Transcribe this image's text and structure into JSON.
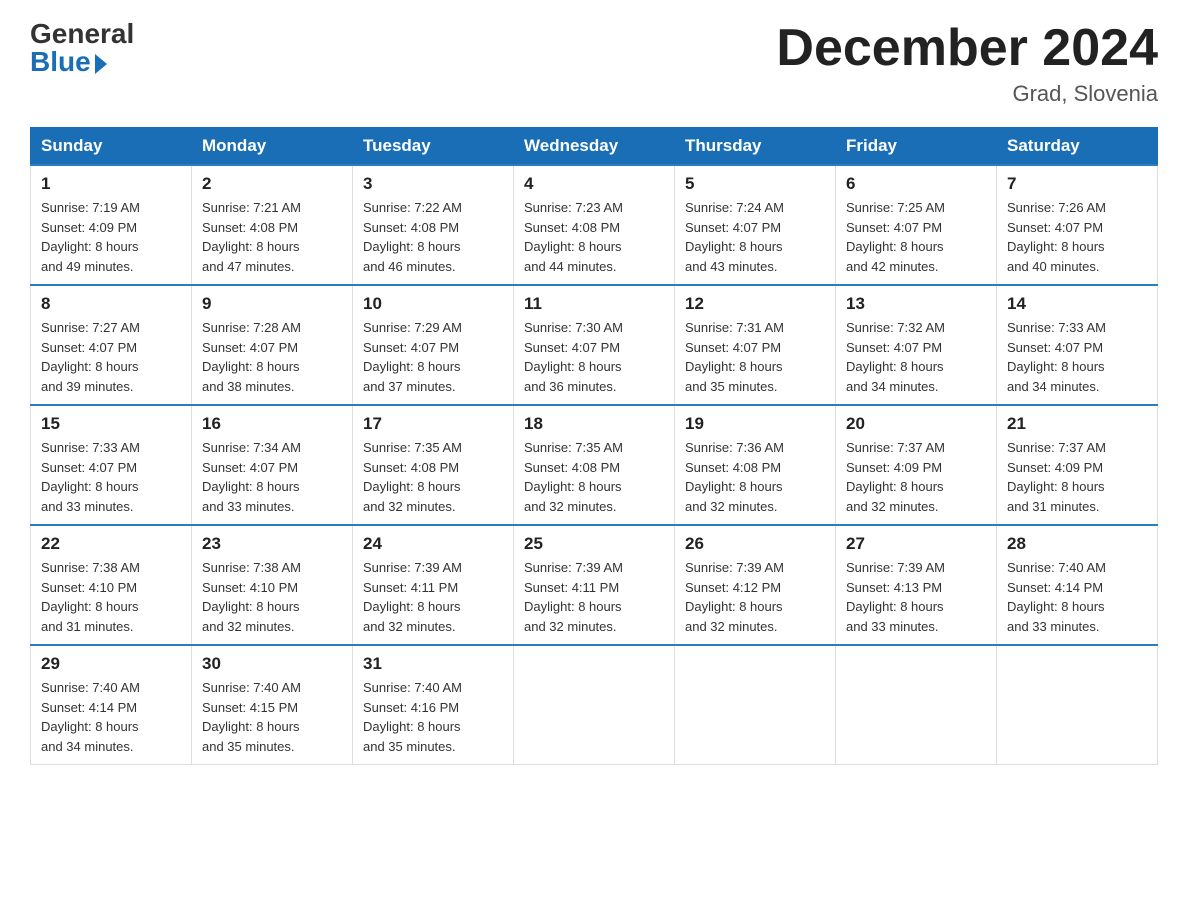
{
  "header": {
    "logo_general": "General",
    "logo_blue": "Blue",
    "month_title": "December 2024",
    "location": "Grad, Slovenia"
  },
  "days_of_week": [
    "Sunday",
    "Monday",
    "Tuesday",
    "Wednesday",
    "Thursday",
    "Friday",
    "Saturday"
  ],
  "weeks": [
    [
      {
        "day": "1",
        "sunrise": "7:19 AM",
        "sunset": "4:09 PM",
        "daylight": "8 hours and 49 minutes."
      },
      {
        "day": "2",
        "sunrise": "7:21 AM",
        "sunset": "4:08 PM",
        "daylight": "8 hours and 47 minutes."
      },
      {
        "day": "3",
        "sunrise": "7:22 AM",
        "sunset": "4:08 PM",
        "daylight": "8 hours and 46 minutes."
      },
      {
        "day": "4",
        "sunrise": "7:23 AM",
        "sunset": "4:08 PM",
        "daylight": "8 hours and 44 minutes."
      },
      {
        "day": "5",
        "sunrise": "7:24 AM",
        "sunset": "4:07 PM",
        "daylight": "8 hours and 43 minutes."
      },
      {
        "day": "6",
        "sunrise": "7:25 AM",
        "sunset": "4:07 PM",
        "daylight": "8 hours and 42 minutes."
      },
      {
        "day": "7",
        "sunrise": "7:26 AM",
        "sunset": "4:07 PM",
        "daylight": "8 hours and 40 minutes."
      }
    ],
    [
      {
        "day": "8",
        "sunrise": "7:27 AM",
        "sunset": "4:07 PM",
        "daylight": "8 hours and 39 minutes."
      },
      {
        "day": "9",
        "sunrise": "7:28 AM",
        "sunset": "4:07 PM",
        "daylight": "8 hours and 38 minutes."
      },
      {
        "day": "10",
        "sunrise": "7:29 AM",
        "sunset": "4:07 PM",
        "daylight": "8 hours and 37 minutes."
      },
      {
        "day": "11",
        "sunrise": "7:30 AM",
        "sunset": "4:07 PM",
        "daylight": "8 hours and 36 minutes."
      },
      {
        "day": "12",
        "sunrise": "7:31 AM",
        "sunset": "4:07 PM",
        "daylight": "8 hours and 35 minutes."
      },
      {
        "day": "13",
        "sunrise": "7:32 AM",
        "sunset": "4:07 PM",
        "daylight": "8 hours and 34 minutes."
      },
      {
        "day": "14",
        "sunrise": "7:33 AM",
        "sunset": "4:07 PM",
        "daylight": "8 hours and 34 minutes."
      }
    ],
    [
      {
        "day": "15",
        "sunrise": "7:33 AM",
        "sunset": "4:07 PM",
        "daylight": "8 hours and 33 minutes."
      },
      {
        "day": "16",
        "sunrise": "7:34 AM",
        "sunset": "4:07 PM",
        "daylight": "8 hours and 33 minutes."
      },
      {
        "day": "17",
        "sunrise": "7:35 AM",
        "sunset": "4:08 PM",
        "daylight": "8 hours and 32 minutes."
      },
      {
        "day": "18",
        "sunrise": "7:35 AM",
        "sunset": "4:08 PM",
        "daylight": "8 hours and 32 minutes."
      },
      {
        "day": "19",
        "sunrise": "7:36 AM",
        "sunset": "4:08 PM",
        "daylight": "8 hours and 32 minutes."
      },
      {
        "day": "20",
        "sunrise": "7:37 AM",
        "sunset": "4:09 PM",
        "daylight": "8 hours and 32 minutes."
      },
      {
        "day": "21",
        "sunrise": "7:37 AM",
        "sunset": "4:09 PM",
        "daylight": "8 hours and 31 minutes."
      }
    ],
    [
      {
        "day": "22",
        "sunrise": "7:38 AM",
        "sunset": "4:10 PM",
        "daylight": "8 hours and 31 minutes."
      },
      {
        "day": "23",
        "sunrise": "7:38 AM",
        "sunset": "4:10 PM",
        "daylight": "8 hours and 32 minutes."
      },
      {
        "day": "24",
        "sunrise": "7:39 AM",
        "sunset": "4:11 PM",
        "daylight": "8 hours and 32 minutes."
      },
      {
        "day": "25",
        "sunrise": "7:39 AM",
        "sunset": "4:11 PM",
        "daylight": "8 hours and 32 minutes."
      },
      {
        "day": "26",
        "sunrise": "7:39 AM",
        "sunset": "4:12 PM",
        "daylight": "8 hours and 32 minutes."
      },
      {
        "day": "27",
        "sunrise": "7:39 AM",
        "sunset": "4:13 PM",
        "daylight": "8 hours and 33 minutes."
      },
      {
        "day": "28",
        "sunrise": "7:40 AM",
        "sunset": "4:14 PM",
        "daylight": "8 hours and 33 minutes."
      }
    ],
    [
      {
        "day": "29",
        "sunrise": "7:40 AM",
        "sunset": "4:14 PM",
        "daylight": "8 hours and 34 minutes."
      },
      {
        "day": "30",
        "sunrise": "7:40 AM",
        "sunset": "4:15 PM",
        "daylight": "8 hours and 35 minutes."
      },
      {
        "day": "31",
        "sunrise": "7:40 AM",
        "sunset": "4:16 PM",
        "daylight": "8 hours and 35 minutes."
      },
      null,
      null,
      null,
      null
    ]
  ],
  "labels": {
    "sunrise": "Sunrise:",
    "sunset": "Sunset:",
    "daylight": "Daylight:"
  }
}
